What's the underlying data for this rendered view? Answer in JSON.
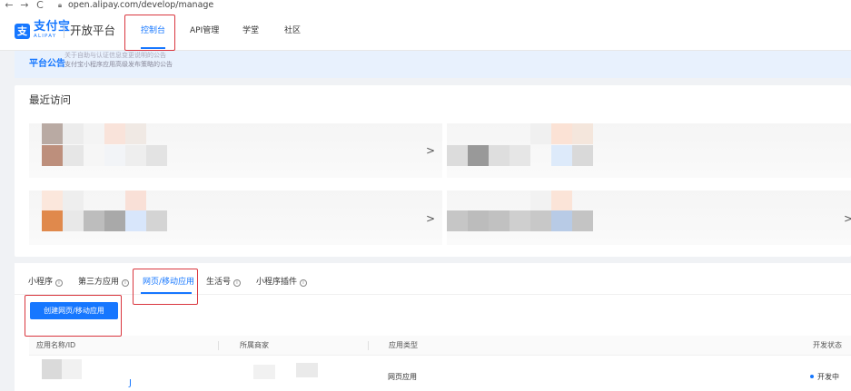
{
  "browser": {
    "back_icon": "←",
    "forward_icon": "→",
    "reload_icon": "C",
    "url": "open.alipay.com/develop/manage"
  },
  "header": {
    "logo_mark": "支",
    "logo_cn": "支付宝",
    "logo_en": "ALIPAY",
    "platform": "开放平台",
    "nav": [
      "控制台",
      "API管理",
      "学堂",
      "社区"
    ]
  },
  "notice": {
    "label": "平台公告",
    "line1": "关于自助与认证信息变更说明的公告",
    "line2": "支付宝小程序应用高级发布策略的公告"
  },
  "recent": {
    "title": "最近访问",
    "chevron": ">"
  },
  "apps": {
    "tabs": [
      "小程序",
      "第三方应用",
      "网页/移动应用",
      "生活号",
      "小程序插件"
    ],
    "info_glyph": "i",
    "create_label": "创建网页/移动应用",
    "columns": [
      "应用名称/ID",
      "所属商家",
      "应用类型",
      "开发状态"
    ],
    "rows": [
      {
        "id_glyph": "J",
        "type": "网页应用",
        "status": "开发中"
      }
    ]
  },
  "colors": {
    "accent": "#1677ff",
    "highlight_box": "#d9363e"
  }
}
